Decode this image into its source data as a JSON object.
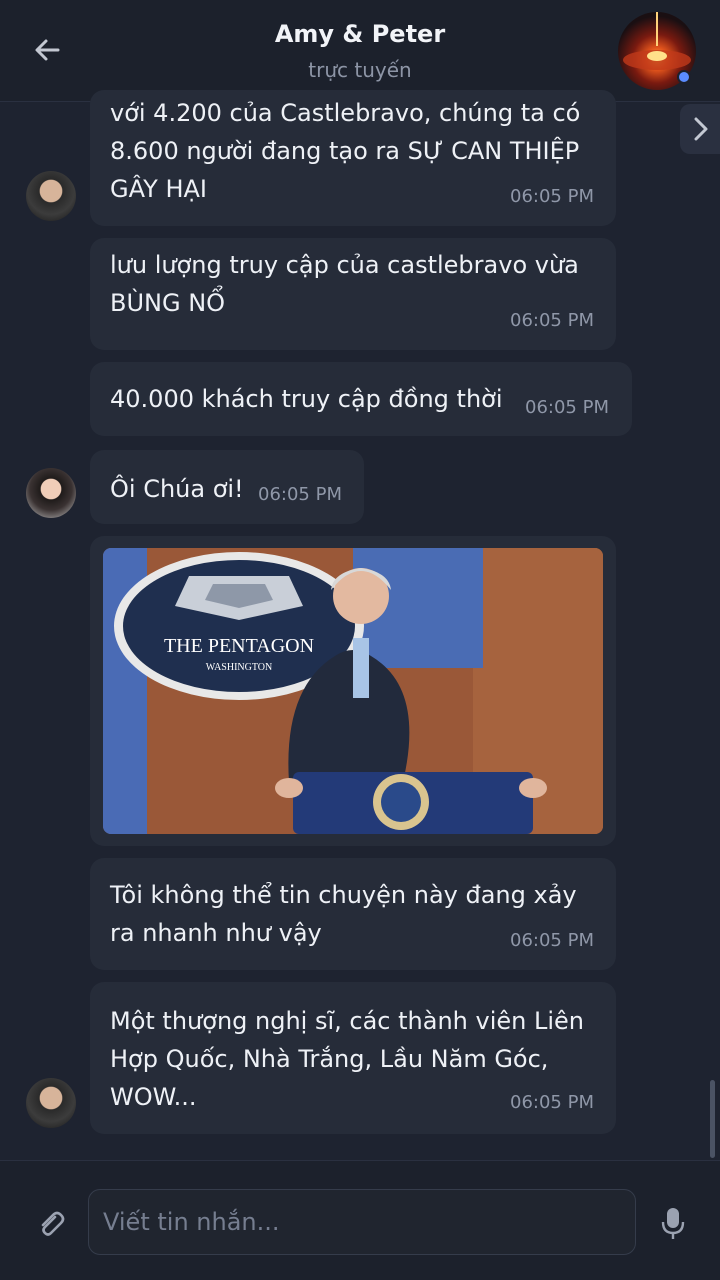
{
  "header": {
    "title": "Amy & Peter",
    "status": "trực tuyến"
  },
  "messages": [
    {
      "text": "với 4.200 của Castlebravo, chúng ta có\n8.600 người đang tạo ra SỰ CAN THIỆP\nGÂY HẠI",
      "time": "06:05 PM"
    },
    {
      "text": "lưu lượng truy cập của castlebravo vừa\nBÙNG NỔ",
      "time": "06:05 PM"
    },
    {
      "text": "40.000 khách truy cập đồng thời",
      "time": "06:05 PM"
    },
    {
      "text": "Ôi Chúa ơi!",
      "time": "06:05 PM"
    },
    {
      "text": "Tôi không thể tin chuyện này đang xảy\nra nhanh như vậy",
      "time": "06:05 PM"
    },
    {
      "text": "Một thượng nghị sĩ, các thành viên Liên\nHợp Quốc, Nhà Trắng, Lầu Năm Góc,\nWOW...",
      "time": "06:05 PM"
    }
  ],
  "photo": {
    "seal_line1": "THE PENTAGON",
    "seal_line2": "WASHINGTON"
  },
  "composer": {
    "placeholder": "Viết tin nhắn..."
  },
  "icons": {
    "back": "arrow-left-icon",
    "next": "chevron-right-icon",
    "attach": "paperclip-icon",
    "mic": "microphone-icon"
  },
  "colors": {
    "background": "#1e2330",
    "bubble": "#262c39",
    "online": "#5b8cff"
  }
}
